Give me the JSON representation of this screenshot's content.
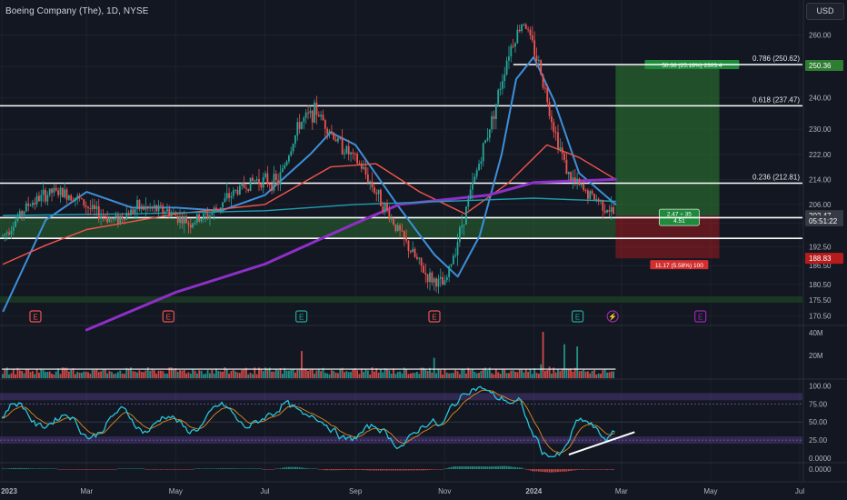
{
  "header": {
    "title": "Boeing Company (The), 1D, NYSE",
    "currency": "USD"
  },
  "colors": {
    "background": "#131722",
    "grid": "#1e222d",
    "candle_up": "#26a69a",
    "candle_down": "#ef5350",
    "ma_fast": "#3d8fd9",
    "ma_mid": "#f2554a",
    "ma_long": "#8e2fc8",
    "ma_teal": "#1f9fb0",
    "zone_green": "#2e7d32",
    "zone_red": "#b71c1c",
    "rsi_line": "#26c6da",
    "rsi_signal": "#e08a1e",
    "rsi_band": "#7e57c2"
  },
  "chart_data": [
    {
      "type": "line",
      "name": "price-pane",
      "title": "Boeing Company (The), 1D, NYSE",
      "x_ticks": [
        "2023",
        "Mar",
        "May",
        "Jul",
        "Sep",
        "Nov",
        "2024",
        "Mar",
        "May",
        "Jul"
      ],
      "y_ticks": [
        260,
        250,
        240,
        230,
        222,
        214,
        206,
        200,
        192.5,
        186.5,
        180.5,
        175.5,
        170.5
      ],
      "y_tick_labels": [
        "260.00",
        "250.00",
        "240.00",
        "230.00",
        "222.00",
        "214.00",
        "206.00",
        "200.00",
        "192.50",
        "186.50",
        "180.50",
        "175.50",
        "170.50"
      ],
      "ylim": [
        168,
        266
      ],
      "price_path": [
        [
          "2023-01-03",
          196
        ],
        [
          "2023-01-20",
          206
        ],
        [
          "2023-02-05",
          210
        ],
        [
          "2023-02-20",
          209
        ],
        [
          "2023-03-05",
          204
        ],
        [
          "2023-03-20",
          201
        ],
        [
          "2023-04-05",
          205
        ],
        [
          "2023-04-25",
          204
        ],
        [
          "2023-05-10",
          200
        ],
        [
          "2023-05-25",
          203
        ],
        [
          "2023-06-10",
          210
        ],
        [
          "2023-06-25",
          214
        ],
        [
          "2023-07-10",
          213
        ],
        [
          "2023-07-25",
          232
        ],
        [
          "2023-08-05",
          236
        ],
        [
          "2023-08-20",
          226
        ],
        [
          "2023-09-05",
          218
        ],
        [
          "2023-09-20",
          206
        ],
        [
          "2023-10-05",
          194
        ],
        [
          "2023-10-20",
          183
        ],
        [
          "2023-11-01",
          180
        ],
        [
          "2023-11-10",
          195
        ],
        [
          "2023-11-25",
          220
        ],
        [
          "2023-12-05",
          236
        ],
        [
          "2023-12-15",
          255
        ],
        [
          "2023-12-25",
          265
        ],
        [
          "2024-01-05",
          250
        ],
        [
          "2024-01-15",
          230
        ],
        [
          "2024-01-25",
          215
        ],
        [
          "2024-02-05",
          210
        ],
        [
          "2024-02-15",
          207
        ],
        [
          "2024-02-26",
          202.5
        ]
      ],
      "moving_averages": [
        {
          "name": "",
          "color": "#3d8fd9",
          "values": [
            [
              "2023-01-03",
              172
            ],
            [
              "2023-02-01",
              201
            ],
            [
              "2023-03-01",
              210
            ],
            [
              "2023-04-01",
              205
            ],
            [
              "2023-05-01",
              205
            ],
            [
              "2023-06-01",
              204
            ],
            [
              "2023-07-01",
              209
            ],
            [
              "2023-08-01",
              222
            ],
            [
              "2023-08-15",
              229
            ],
            [
              "2023-09-01",
              225
            ],
            [
              "2023-10-01",
              205
            ],
            [
              "2023-10-25",
              190
            ],
            [
              "2023-11-10",
              183
            ],
            [
              "2023-11-25",
              196
            ],
            [
              "2023-12-10",
              222
            ],
            [
              "2023-12-20",
              246
            ],
            [
              "2024-01-01",
              253
            ],
            [
              "2024-01-15",
              239
            ],
            [
              "2024-02-01",
              216
            ],
            [
              "2024-02-26",
              206
            ]
          ]
        },
        {
          "name": "",
          "color": "#f2554a",
          "values": [
            [
              "2023-01-03",
              187
            ],
            [
              "2023-02-01",
              193
            ],
            [
              "2023-03-01",
              198
            ],
            [
              "2023-05-01",
              203
            ],
            [
              "2023-07-01",
              206
            ],
            [
              "2023-08-15",
              218
            ],
            [
              "2023-09-15",
              219
            ],
            [
              "2023-10-15",
              210
            ],
            [
              "2023-11-15",
              203
            ],
            [
              "2023-12-15",
              213
            ],
            [
              "2024-01-10",
              225
            ],
            [
              "2024-02-01",
              221
            ],
            [
              "2024-02-26",
              214
            ]
          ]
        },
        {
          "name": "",
          "color": "#8e2fc8",
          "values": [
            [
              "2023-03-01",
              166
            ],
            [
              "2023-05-01",
              178
            ],
            [
              "2023-07-01",
              187
            ],
            [
              "2023-09-01",
              200
            ],
            [
              "2023-10-01",
              206
            ],
            [
              "2023-12-01",
              209
            ],
            [
              "2024-01-01",
              213
            ],
            [
              "2024-02-26",
              214
            ]
          ]
        },
        {
          "name": "",
          "color": "#1f9fb0",
          "values": [
            [
              "2023-01-03",
              202.5
            ],
            [
              "2023-04-01",
              203
            ],
            [
              "2023-07-01",
              204
            ],
            [
              "2023-09-01",
              206
            ],
            [
              "2023-11-01",
              207
            ],
            [
              "2024-01-01",
              208
            ],
            [
              "2024-02-26",
              207
            ]
          ]
        }
      ],
      "fib_levels": [
        {
          "label": "0.786 (250.62)",
          "value": 250.62
        },
        {
          "label": "0.618 (237.47)",
          "value": 237.47
        },
        {
          "label": "0.236 (212.81)",
          "value": 212.81
        }
      ],
      "support_lines": [
        201.8,
        195.2
      ],
      "support_zone": [
        195.2,
        201.8
      ],
      "position": {
        "entry": 202.47,
        "target": 250.36,
        "stop": 188.83,
        "target_label": "50.36 (25.18%) 2303.4",
        "stop_label": "11.17 (5.58%) 100",
        "rr_label_1": "2.47 ÷ 35",
        "rr_label_2": "4.51"
      },
      "price_labels": [
        {
          "text": "250.36",
          "value": 250.36,
          "color": "#2e7d32"
        },
        {
          "text": "202.47",
          "value": 202.47,
          "color": "#363a45"
        },
        {
          "text": "05:51:22",
          "value": 200.8,
          "color": "#363a45"
        },
        {
          "text": "188.83",
          "value": 188.83,
          "color": "#b71c1c"
        }
      ],
      "events": [
        {
          "label": "E",
          "color": "#ef5350",
          "x": "2023-01-25"
        },
        {
          "label": "E",
          "color": "#ef5350",
          "x": "2023-04-26"
        },
        {
          "label": "E",
          "color": "#26a69a",
          "x": "2023-07-26"
        },
        {
          "label": "E",
          "color": "#ef5350",
          "x": "2023-10-25"
        },
        {
          "label": "E",
          "color": "#26a69a",
          "x": "2024-01-31"
        },
        {
          "label": "⚡",
          "color": "#9c27b0",
          "x": "2024-02-24"
        },
        {
          "label": "E",
          "color": "#9c27b0",
          "x": "2024-04-24"
        }
      ]
    },
    {
      "type": "bar",
      "name": "volume-pane",
      "y_tick_labels": [
        "40M",
        "20M"
      ],
      "y_ticks": [
        40,
        20
      ],
      "ylim": [
        0,
        45
      ],
      "spikes": [
        [
          "2023-07-26",
          24
        ],
        [
          "2023-10-25",
          18
        ],
        [
          "2024-01-08",
          41
        ],
        [
          "2024-01-22",
          30
        ],
        [
          "2024-01-31",
          28
        ]
      ],
      "baseline": 8
    },
    {
      "type": "line",
      "name": "rsi-pane",
      "y_tick_labels": [
        "100.00",
        "75.00",
        "50.00",
        "25.00",
        "0.0000"
      ],
      "y_ticks": [
        100,
        75,
        50,
        25,
        0
      ],
      "ylim": [
        -5,
        108
      ],
      "bands": [
        [
          80,
          90
        ],
        [
          20,
          30
        ]
      ],
      "trendline": [
        [
          "2024-01-25",
          5
        ],
        [
          "2024-03-10",
          36
        ]
      ]
    },
    {
      "type": "bar",
      "name": "macd-pane",
      "y_tick_labels": [
        "0.0000"
      ],
      "y_ticks": [
        0
      ]
    }
  ]
}
